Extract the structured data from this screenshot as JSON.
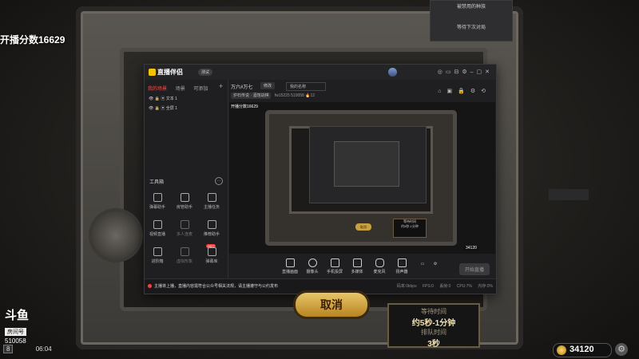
{
  "game": {
    "stream_score": "开播分数16629",
    "banned_race": "被禁用的种族",
    "wait_next_round": "等待下次对局",
    "cancel_label": "取消",
    "wait_title": "等待时间",
    "wait_estimate": "约5秒-1分钟",
    "queue_label": "排队时间",
    "queue_time": "3秒",
    "coins": "34120",
    "brand": "斗鱼",
    "room_label": "房间号",
    "room_id": "510058",
    "level": "8",
    "clock": "06:04"
  },
  "app": {
    "name": "直播伴侣",
    "version": "测试",
    "tabs": [
      "我的场景",
      "场景",
      "可添加"
    ],
    "layers": [
      "文本 1",
      "全屏 1"
    ],
    "tools_title": "工具箱",
    "tools": [
      {
        "label": "弹幕助手"
      },
      {
        "label": "房管助手"
      },
      {
        "label": "主播任务"
      },
      {
        "label": "视频直播"
      },
      {
        "label": "多人连麦"
      },
      {
        "label": "推荐助手"
      },
      {
        "label": "进阶箱"
      },
      {
        "label": "虚拟形象"
      },
      {
        "label": "弹幕库"
      }
    ],
    "room_title": "万六#万七",
    "edit_label": "修改",
    "room_name": "我的名称",
    "category": "炉石传说 · 酒馆战棋",
    "fans": "fw15225",
    "room_number": "510058",
    "hot": "12",
    "preview_label": "开播分数16629",
    "bottom_items": [
      "直播画面",
      "摄像头",
      "手机投屏",
      "多媒体",
      "麦克风",
      "扬声器"
    ],
    "go_live": "开始直播",
    "warning": "主播将上播，直播内容需符合公众号相关法规，请主播遵守与公约发布",
    "stats": "码率:0kbps FPS:0 丢帧:0 CPU:7% 内存:0%"
  }
}
